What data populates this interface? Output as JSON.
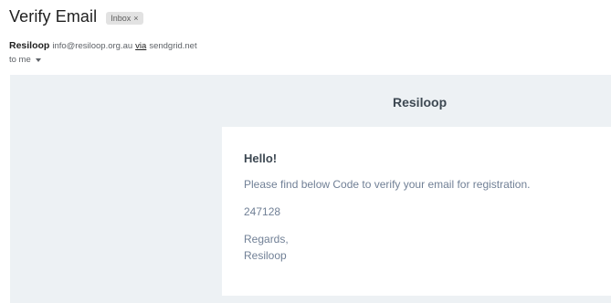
{
  "header": {
    "subject": "Verify Email",
    "label_badge": "Inbox",
    "label_remove": "×"
  },
  "sender": {
    "name": "Resiloop",
    "email": "info@resiloop.org.au",
    "via": "via",
    "via_domain": "sendgrid.net",
    "recipient": "to me"
  },
  "body": {
    "brand": "Resiloop",
    "greeting": "Hello!",
    "message": "Please find below Code to verify your email for registration.",
    "code": "247128",
    "signoff": "Regards,",
    "signature": "Resiloop"
  },
  "colors": {
    "body_background": "#edf1f4",
    "heading_text": "#3d4852",
    "body_text": "#718096"
  }
}
